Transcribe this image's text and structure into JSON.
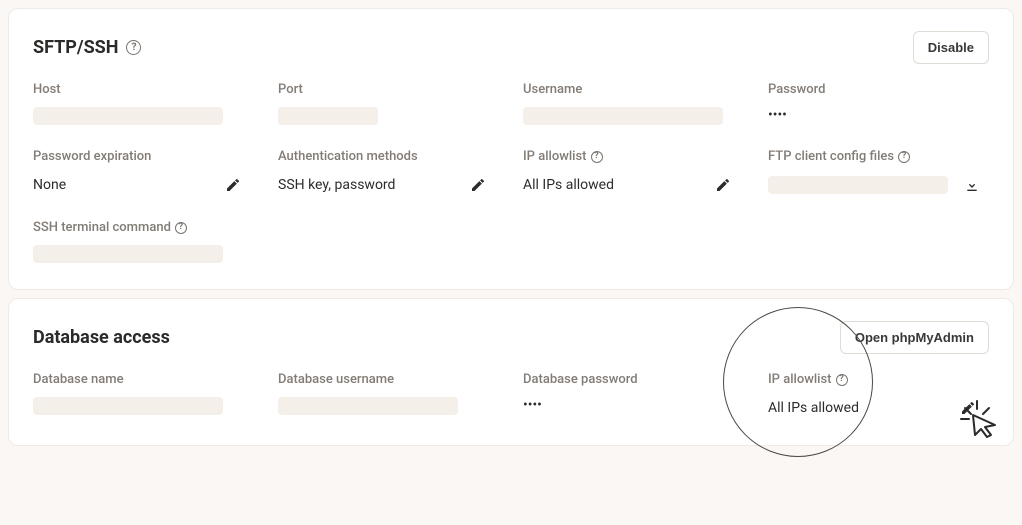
{
  "sftp": {
    "title": "SFTP/SSH",
    "disable_label": "Disable",
    "fields": {
      "host_label": "Host",
      "port_label": "Port",
      "username_label": "Username",
      "password_label": "Password",
      "password_value": "••••",
      "pw_exp_label": "Password expiration",
      "pw_exp_value": "None",
      "auth_label": "Authentication methods",
      "auth_value": "SSH key, password",
      "ip_label": "IP allowlist",
      "ip_value": "All IPs allowed",
      "ftp_client_label": "FTP client config files",
      "ssh_cmd_label": "SSH terminal command"
    }
  },
  "db": {
    "title": "Database access",
    "open_btn": "Open phpMyAdmin",
    "fields": {
      "name_label": "Database name",
      "user_label": "Database username",
      "pw_label": "Database password",
      "pw_value": "••••",
      "ip_label": "IP allowlist",
      "ip_value": "All IPs allowed"
    }
  }
}
